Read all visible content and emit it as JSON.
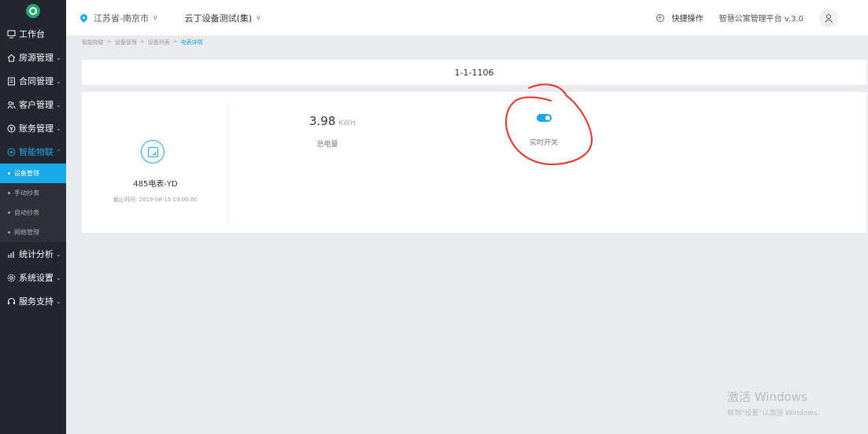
{
  "sidebar": {
    "items": [
      {
        "label": "工作台",
        "icon": "monitor-icon"
      },
      {
        "label": "房源管理",
        "icon": "home-icon"
      },
      {
        "label": "合同管理",
        "icon": "contract-icon"
      },
      {
        "label": "客户管理",
        "icon": "users-icon"
      },
      {
        "label": "账务管理",
        "icon": "yen-icon"
      },
      {
        "label": "智能物联",
        "icon": "iot-icon"
      }
    ],
    "sub_items": [
      {
        "label": "设备管理"
      },
      {
        "label": "手动抄表"
      },
      {
        "label": "自动抄表"
      },
      {
        "label": "网络管理"
      }
    ],
    "items_after": [
      {
        "label": "统计分析",
        "icon": "chart-icon"
      },
      {
        "label": "系统设置",
        "icon": "settings-icon"
      },
      {
        "label": "服务支持",
        "icon": "headset-icon"
      }
    ]
  },
  "header": {
    "location": "江苏省-南京市",
    "project": "云丁设备测试(集)",
    "quick_action": "快捷操作",
    "platform": "智慧公寓管理平台 v.3.0"
  },
  "breadcrumb": {
    "items": [
      "智能物联",
      "设备管理",
      "设备列表",
      "电表详情"
    ],
    "separator": ">"
  },
  "detail": {
    "room": "1-1-1106",
    "device_name": "485电表-YD",
    "deadline": "截止时间: 2019-08-15 19:00:00",
    "total_power_value": "3.98",
    "total_power_unit": "KWH",
    "total_power_label": "总电量",
    "switch_label": "实时开关",
    "switch_on": true
  },
  "watermark": {
    "line1": "激活 Windows",
    "line2": "转到\"设置\"以激活 Windows。"
  },
  "colors": {
    "accent": "#1aa9e8",
    "sidebar_bg": "#23262e",
    "annotation": "#e8302a"
  }
}
